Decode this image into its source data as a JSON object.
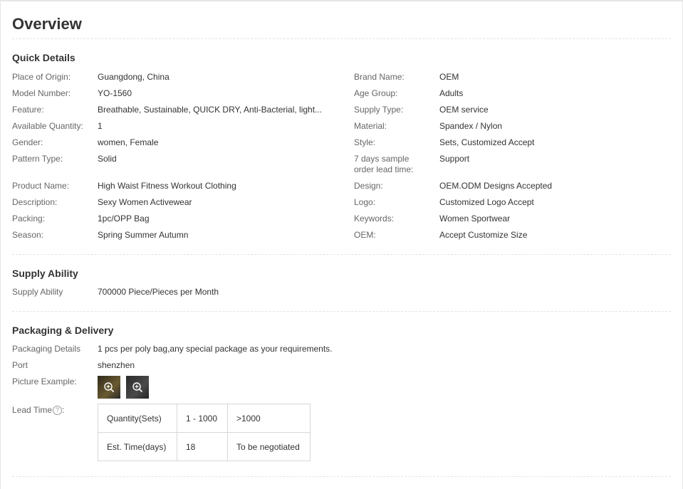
{
  "title": "Overview",
  "quick_details": {
    "heading": "Quick Details",
    "left": [
      {
        "label": "Place of Origin:",
        "value": "Guangdong, China"
      },
      {
        "label": "Model Number:",
        "value": "YO-1560"
      },
      {
        "label": "Feature:",
        "value": "Breathable, Sustainable, QUICK DRY, Anti-Bacterial, light..."
      },
      {
        "label": "Available Quantity:",
        "value": "1"
      },
      {
        "label": "Gender:",
        "value": "women, Female"
      },
      {
        "label": "Pattern Type:",
        "value": "Solid"
      },
      {
        "label": "Product Name:",
        "value": "High Waist Fitness Workout Clothing"
      },
      {
        "label": "Description:",
        "value": "Sexy Women Activewear"
      },
      {
        "label": "Packing:",
        "value": "1pc/OPP Bag"
      },
      {
        "label": "Season:",
        "value": "Spring Summer Autumn"
      }
    ],
    "right": [
      {
        "label": "Brand Name:",
        "value": "OEM"
      },
      {
        "label": "Age Group:",
        "value": "Adults"
      },
      {
        "label": "Supply Type:",
        "value": "OEM service"
      },
      {
        "label": "Material:",
        "value": "Spandex / Nylon"
      },
      {
        "label": "Style:",
        "value": "Sets, Customized Accept"
      },
      {
        "label": "7 days sample order lead time:",
        "value": "Support"
      },
      {
        "label": "Design:",
        "value": "OEM.ODM Designs Accepted"
      },
      {
        "label": "Logo:",
        "value": "Customized Logo Accept"
      },
      {
        "label": "Keywords:",
        "value": "Women Sportwear"
      },
      {
        "label": "OEM:",
        "value": "Accept Customize Size"
      }
    ]
  },
  "supply_ability": {
    "heading": "Supply Ability",
    "label": "Supply Ability",
    "value": "700000 Piece/Pieces per Month"
  },
  "packaging": {
    "heading": "Packaging & Delivery",
    "details_label": "Packaging Details",
    "details_value": "1 pcs per poly bag,any special package as your requirements.",
    "port_label": "Port",
    "port_value": "shenzhen",
    "picture_label": "Picture Example:",
    "lead_label": "Lead Time",
    "lead_suffix": ":",
    "help_glyph": "?",
    "zoom_glyph": "⊕",
    "lead_table": {
      "row1": [
        "Quantity(Sets)",
        "1 - 1000",
        ">1000"
      ],
      "row2": [
        "Est. Time(days)",
        "18",
        "To be negotiated"
      ]
    }
  }
}
